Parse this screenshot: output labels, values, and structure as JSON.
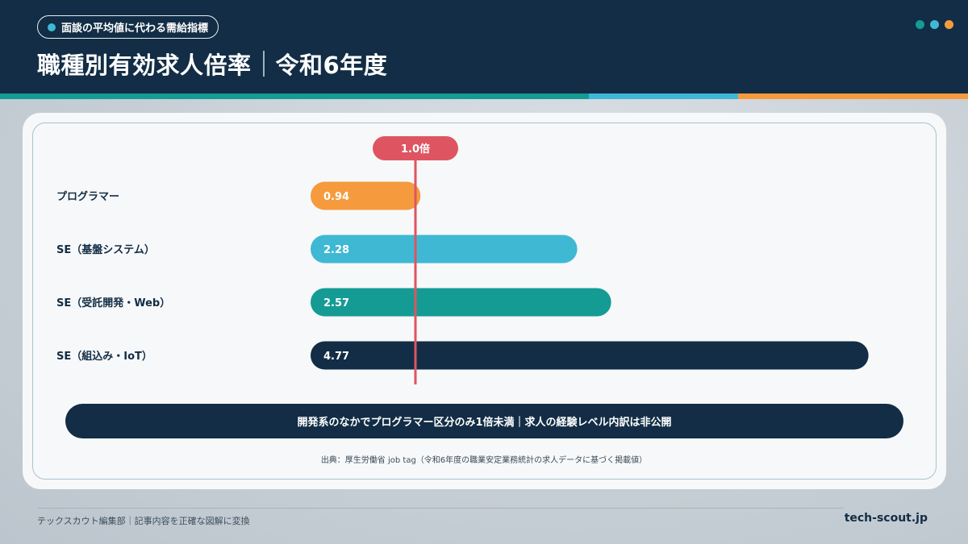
{
  "header": {
    "badge": "面談の平均値に代わる需給指標",
    "title_main": "職種別有効求人倍率",
    "title_sub": "令和6年度"
  },
  "colors": {
    "navy": "#122d45",
    "orange": "#f59b3e",
    "light_blue": "#3fb8d4",
    "teal": "#149b94",
    "red": "#de5561"
  },
  "chart_data": {
    "type": "bar",
    "orientation": "horizontal",
    "title": "職種別有効求人倍率｜令和6年度",
    "categories": [
      "プログラマー",
      "SE（基盤システム）",
      "SE（受託開発・Web）",
      "SE（組込み・IoT）"
    ],
    "values": [
      0.94,
      2.28,
      2.57,
      4.77
    ],
    "value_labels": [
      "0.94",
      "2.28",
      "2.57",
      "4.77"
    ],
    "bar_colors": [
      "#f59b3e",
      "#3fb8d4",
      "#149b94",
      "#122d45"
    ],
    "reference_line": {
      "value": 1.0,
      "label": "1.0倍",
      "color": "#de5561"
    },
    "xlim": [
      0,
      5.0
    ],
    "grid": false
  },
  "banner": "開発系のなかでプログラマー区分のみ1倍未満｜求人の経験レベル内訳は非公開",
  "source": "出典：厚生労働省 job tag（令和6年度の職業安定業務統計の求人データに基づく掲載値）",
  "footer": {
    "left": "テックスカウト編集部｜記事内容を正確な図解に変換",
    "right": "tech-scout.jp"
  }
}
